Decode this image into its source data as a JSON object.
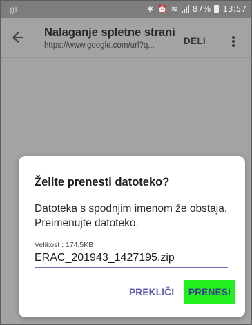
{
  "status_bar": {
    "battery_percent": "87%",
    "time": "13:57"
  },
  "app_bar": {
    "title": "Nalaganje spletne strani",
    "url": "https://www.google.com/url?q...",
    "share_label": "DELI"
  },
  "dialog": {
    "title": "Želite prenesti datoteko?",
    "message": "Datoteka s spodnjim imenom že obstaja. Preimenujte datoteko.",
    "size_label": "Velikost : 174,5KB",
    "filename_value": "ERAC_201943_1427195.zip",
    "cancel_label": "PREKLIČI",
    "download_label": "PRENESI"
  },
  "colors": {
    "accent": "#5b5fb0",
    "download_highlight": "#22f01e",
    "scrim": "#a3a3a3"
  },
  "icons": [
    "vibrate-icon",
    "bluetooth-icon",
    "alarm-icon",
    "wifi-icon",
    "signal-icon",
    "battery-icon",
    "back-arrow-icon",
    "more-vert-icon"
  ]
}
